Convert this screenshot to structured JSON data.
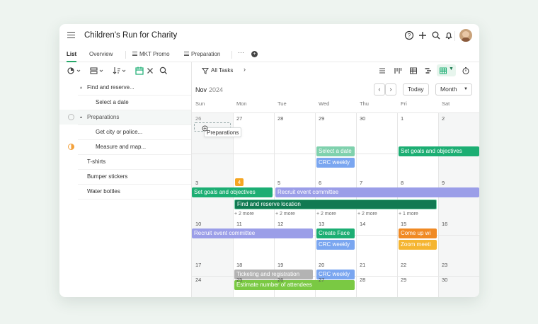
{
  "header": {
    "project_title": "Children's Run for Charity"
  },
  "tabs": {
    "list": "List",
    "overview": "Overview",
    "mkt_promo": "MKT Promo",
    "preparation": "Preparation",
    "more": "···"
  },
  "task_list": [
    {
      "label": "Find and reserve..."
    },
    {
      "label": "Select a date"
    },
    {
      "label": "Preparations"
    },
    {
      "label": "Get city or police..."
    },
    {
      "label": "Measure and map..."
    },
    {
      "label": "T-shirts"
    },
    {
      "label": "Bumper stickers"
    },
    {
      "label": "Water bottles"
    }
  ],
  "calendar": {
    "filter_label": "All Tasks",
    "month": "Nov",
    "year": "2024",
    "today_button": "Today",
    "view_select": "Month",
    "weekdays": [
      "Sun",
      "Mon",
      "Tue",
      "Wed",
      "Thu",
      "Fri",
      "Sat"
    ],
    "weeks": [
      [
        "26",
        "27",
        "28",
        "29",
        "30",
        "1",
        "2"
      ],
      [
        "3",
        "4",
        "5",
        "6",
        "7",
        "8",
        "9"
      ],
      [
        "10",
        "11",
        "12",
        "13",
        "14",
        "15",
        "16"
      ],
      [
        "17",
        "18",
        "19",
        "20",
        "21",
        "22",
        "23"
      ],
      [
        "24",
        "25",
        "26",
        "27",
        "28",
        "29",
        "30"
      ]
    ],
    "today_marker": "4",
    "drag_preview": "Preparations",
    "events": {
      "w1_select_date": "Select a date",
      "w1_crc_weekly": "CRC weekly",
      "w1_set_goals": "Set goals and objectives",
      "w2_set_goals": "Set goals and objectives",
      "w2_recruit": "Recruit event committee",
      "w2_find_reserve": "Find and reserve location",
      "w3_recruit": "Recruit event committee",
      "w3_create_face": "Create Face",
      "w3_come_up": "Come up wi",
      "w3_crc_weekly": "CRC weekly",
      "w3_zoom": "Zoom meeti",
      "w4_ticketing": "Ticketing and registration",
      "w4_crc_weekly": "CRC weekly",
      "w4_estimate": "Estimate number of attendees"
    },
    "more_links": [
      "+ 2 more",
      "+ 2 more",
      "+ 2 more",
      "+ 2 more",
      "+ 1 more"
    ]
  },
  "colors": {
    "green": "#1cae73",
    "light_green": "#7fd1ad",
    "dark_green": "#117a52",
    "purple": "#9b9ee8",
    "blue": "#7aa6f0",
    "orange": "#f08a24",
    "amber": "#f5b531",
    "gray": "#b3b3b3",
    "lime": "#7ac943",
    "today": "#f5a623"
  }
}
